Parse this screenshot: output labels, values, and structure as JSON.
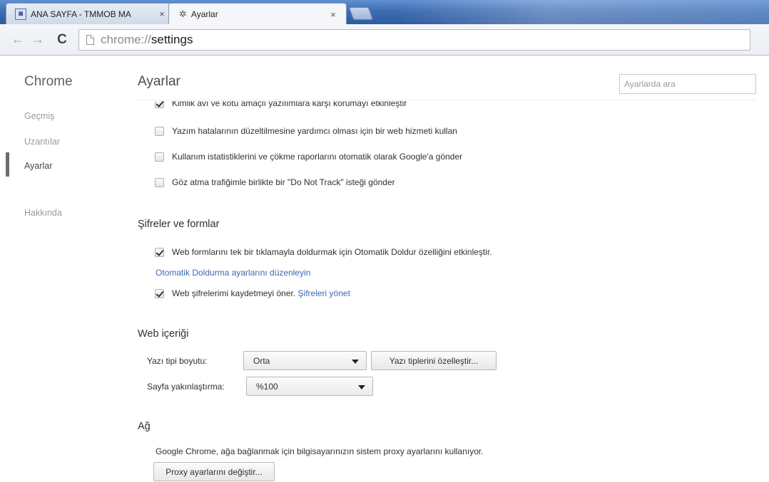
{
  "tabs": [
    {
      "title": "ANA SAYFA - TMMOB MA",
      "icon": "site-favicon",
      "close": "×"
    },
    {
      "title": "Ayarlar",
      "icon": "gear-icon",
      "close": "×"
    }
  ],
  "toolbar": {
    "back": "←",
    "forward": "→",
    "reload": "C",
    "url_scheme": "chrome://",
    "url_host": "settings"
  },
  "sidebar": {
    "brand": "Chrome",
    "items": [
      {
        "label": "Geçmiş"
      },
      {
        "label": "Uzantılar"
      },
      {
        "label": "Ayarlar",
        "selected": true
      },
      {
        "label": "Hakkında"
      }
    ]
  },
  "main": {
    "title": "Ayarlar",
    "search_placeholder": "Ayarlarda ara",
    "privacy_options": [
      {
        "label": "Kimlik avı ve kötü amaçlı yazılımlara karşı korumayı etkinleştir",
        "checked": true
      },
      {
        "label": "Yazım hatalarının düzeltilmesine yardımcı olması için bir web hizmeti kullan",
        "checked": false
      },
      {
        "label": "Kullanım istatistiklerini ve çökme raporlarını otomatik olarak Google'a gönder",
        "checked": false
      },
      {
        "label": "Göz atma trafiğimle birlikte bir \"Do Not Track\" isteği gönder",
        "checked": false
      }
    ],
    "passwords": {
      "title": "Şifreler ve formlar",
      "autofill_label": "Web formlarını tek bir tıklamayla doldurmak için Otomatik Doldur özelliğini etkinleştir.",
      "autofill_checked": true,
      "autofill_link": "Otomatik Doldurma ayarlarını düzenleyin",
      "save_label": "Web şifrelerimi kaydetmeyi öner.",
      "save_checked": true,
      "manage_link": "Şifreleri yönet"
    },
    "web_content": {
      "title": "Web içeriği",
      "font_size_label": "Yazı tipi boyutu:",
      "font_size_value": "Orta",
      "customize_fonts_button": "Yazı tiplerini özelleştir...",
      "zoom_label": "Sayfa yakınlaştırma:",
      "zoom_value": "%100"
    },
    "network": {
      "title": "Ağ",
      "description": "Google Chrome, ağa bağlanmak için bilgisayarınızın sistem proxy ayarlarını kullanıyor.",
      "proxy_button": "Proxy ayarlarını değiştir..."
    }
  }
}
